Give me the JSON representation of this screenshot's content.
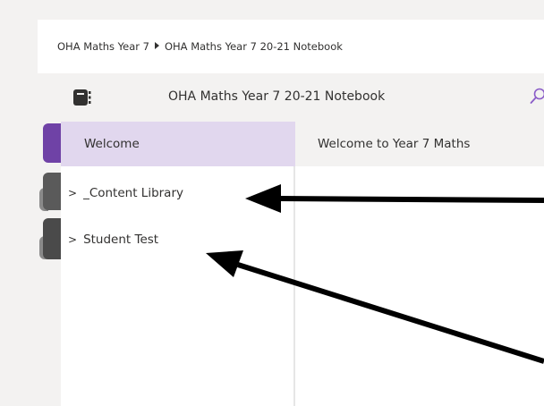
{
  "breadcrumb": {
    "items": [
      "OHA Maths Year 7",
      "OHA Maths Year 7 20-21 Notebook"
    ]
  },
  "notebook": {
    "title": "OHA Maths Year 7 20-21 Notebook",
    "icon": "notebook-icon",
    "search_icon": "search-icon"
  },
  "sections": {
    "tab_colors": [
      "#6f42a6",
      "#5a5a5a",
      "#4a4a4a"
    ]
  },
  "pages": {
    "header": "Welcome",
    "items": [
      {
        "label": "_Content Library",
        "expander": ">"
      },
      {
        "label": "Student Test",
        "expander": ">"
      }
    ]
  },
  "content": {
    "header": "Welcome to Year 7 Maths"
  },
  "colors": {
    "accent": "#6f42a6",
    "selected_row": "#e1d7ee",
    "arrow": "#000000"
  }
}
